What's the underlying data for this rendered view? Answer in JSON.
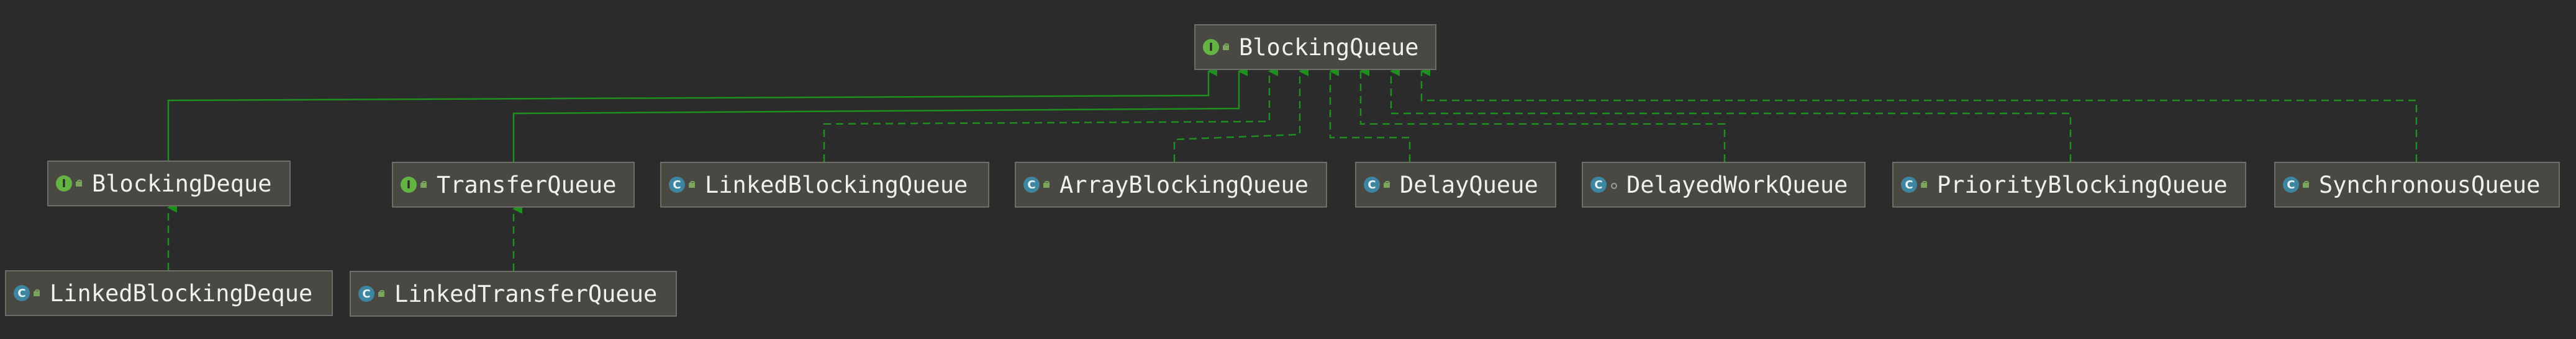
{
  "diagram": {
    "root": {
      "id": "blocking-queue",
      "name": "BlockingQueue",
      "kind": "interface"
    },
    "nodes": [
      {
        "id": "blocking-deque",
        "name": "BlockingDeque",
        "kind": "interface"
      },
      {
        "id": "transfer-queue",
        "name": "TransferQueue",
        "kind": "interface"
      },
      {
        "id": "linked-blocking-queue",
        "name": "LinkedBlockingQueue",
        "kind": "class"
      },
      {
        "id": "array-blocking-queue",
        "name": "ArrayBlockingQueue",
        "kind": "class"
      },
      {
        "id": "delay-queue",
        "name": "DelayQueue",
        "kind": "class"
      },
      {
        "id": "delayed-work-queue",
        "name": "DelayedWorkQueue",
        "kind": "inner-class"
      },
      {
        "id": "priority-blocking-queue",
        "name": "PriorityBlockingQueue",
        "kind": "class"
      },
      {
        "id": "synchronous-queue",
        "name": "SynchronousQueue",
        "kind": "class"
      },
      {
        "id": "linked-blocking-deque",
        "name": "LinkedBlockingDeque",
        "kind": "class"
      },
      {
        "id": "linked-transfer-queue",
        "name": "LinkedTransferQueue",
        "kind": "class"
      }
    ],
    "edges": [
      {
        "from": "blocking-deque",
        "to": "blocking-queue",
        "type": "extends"
      },
      {
        "from": "transfer-queue",
        "to": "blocking-queue",
        "type": "extends"
      },
      {
        "from": "linked-blocking-queue",
        "to": "blocking-queue",
        "type": "implements"
      },
      {
        "from": "array-blocking-queue",
        "to": "blocking-queue",
        "type": "implements"
      },
      {
        "from": "delay-queue",
        "to": "blocking-queue",
        "type": "implements"
      },
      {
        "from": "delayed-work-queue",
        "to": "blocking-queue",
        "type": "implements"
      },
      {
        "from": "priority-blocking-queue",
        "to": "blocking-queue",
        "type": "implements"
      },
      {
        "from": "synchronous-queue",
        "to": "blocking-queue",
        "type": "implements"
      },
      {
        "from": "linked-blocking-deque",
        "to": "blocking-deque",
        "type": "implements"
      },
      {
        "from": "linked-transfer-queue",
        "to": "transfer-queue",
        "type": "implements"
      }
    ],
    "colors": {
      "background": "#2b2b2b",
      "node_fill": "#4a4843",
      "node_border": "#6f6d68",
      "edge": "#1f8f1f",
      "interface_badge": "#62b543",
      "class_badge": "#3e86a0"
    },
    "badge_glyphs": {
      "interface": "I",
      "class": "C",
      "inner-class": "C"
    }
  }
}
